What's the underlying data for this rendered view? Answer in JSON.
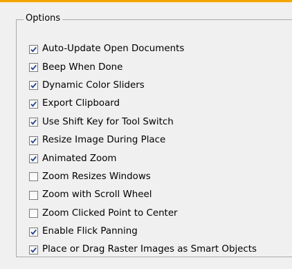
{
  "section": {
    "legend": "Options"
  },
  "options": [
    {
      "label": "Auto-Update Open Documents",
      "checked": true
    },
    {
      "label": "Beep When Done",
      "checked": true
    },
    {
      "label": "Dynamic Color Sliders",
      "checked": true
    },
    {
      "label": "Export Clipboard",
      "checked": true
    },
    {
      "label": "Use Shift Key for Tool Switch",
      "checked": true
    },
    {
      "label": "Resize Image During Place",
      "checked": true
    },
    {
      "label": "Animated Zoom",
      "checked": true
    },
    {
      "label": "Zoom Resizes Windows",
      "checked": false
    },
    {
      "label": "Zoom with Scroll Wheel",
      "checked": false
    },
    {
      "label": "Zoom Clicked Point to Center",
      "checked": false
    },
    {
      "label": "Enable Flick Panning",
      "checked": true
    },
    {
      "label": "Place or Drag Raster Images as Smart Objects",
      "checked": true
    }
  ],
  "colors": {
    "accent_strip": "#f4a400",
    "checkmark": "#1f3f8f",
    "background": "#f0f0f0"
  }
}
